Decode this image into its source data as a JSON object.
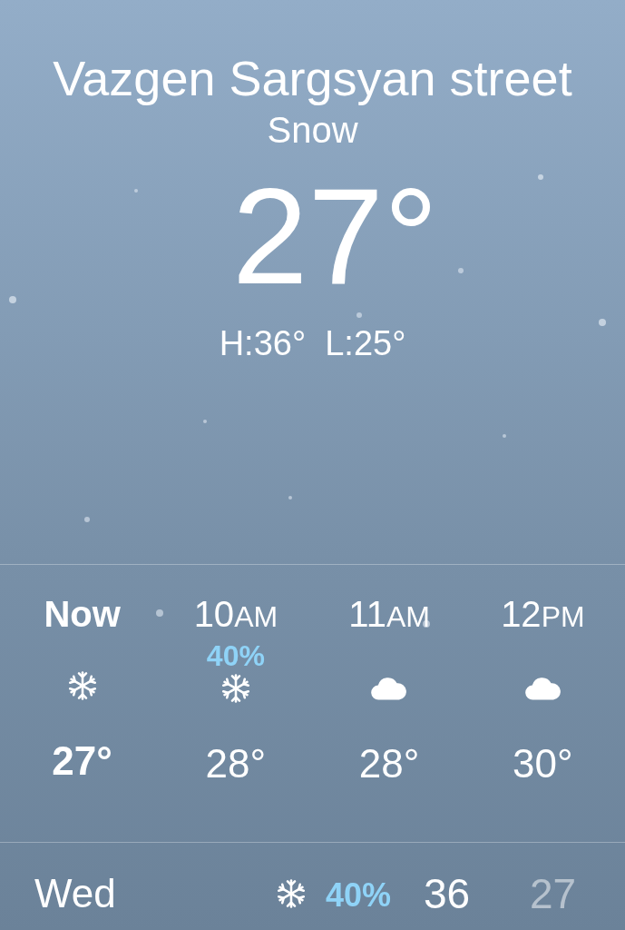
{
  "location": "Vazgen Sargsyan street",
  "condition": "Snow",
  "temperature": "27°",
  "high_low": "H:36°  L:25°",
  "hourly": [
    {
      "time": "Now",
      "current": true,
      "kind": "snow",
      "temp": "27°"
    },
    {
      "time": "10",
      "period": "AM",
      "current": false,
      "precip": "40%",
      "kind": "snow",
      "temp": "28°"
    },
    {
      "time": "11",
      "period": "AM",
      "current": false,
      "kind": "cloud",
      "temp": "28°"
    },
    {
      "time": "12",
      "period": "PM",
      "current": false,
      "kind": "cloud",
      "temp": "30°"
    }
  ],
  "daily": [
    {
      "day": "Wed",
      "kind": "snow",
      "precip": "40%",
      "high": "36",
      "low": "27"
    }
  ]
}
